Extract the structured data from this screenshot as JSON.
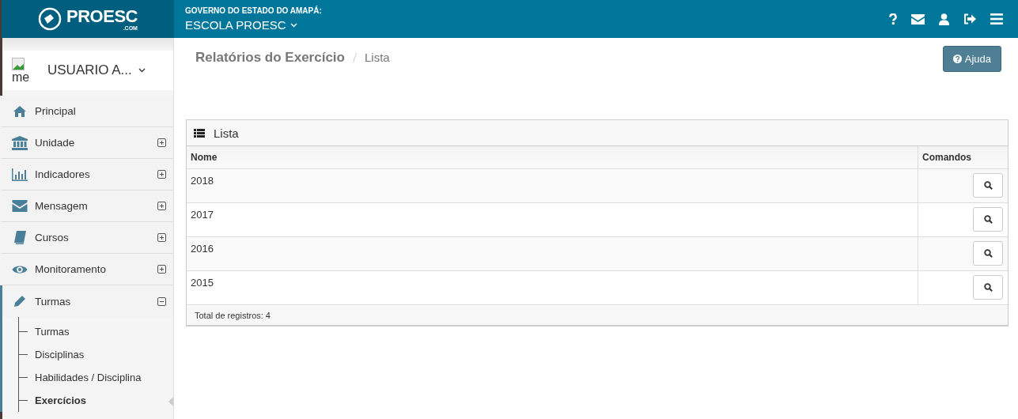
{
  "header": {
    "logo": "PROESC",
    "logo_sub": ".COM",
    "org": "GOVERNO DO ESTADO DO AMAPÁ:",
    "school": "ESCOLA PROESC"
  },
  "user": {
    "image_alt": "me",
    "name": "USUARIO A..."
  },
  "sidebar": {
    "items": [
      {
        "label": "Principal"
      },
      {
        "label": "Unidade",
        "expanded": false
      },
      {
        "label": "Indicadores",
        "expanded": false
      },
      {
        "label": "Mensagem",
        "expanded": false
      },
      {
        "label": "Cursos",
        "expanded": false
      },
      {
        "label": "Monitoramento",
        "expanded": false
      },
      {
        "label": "Turmas",
        "expanded": true,
        "children": [
          {
            "label": "Turmas",
            "selected": false
          },
          {
            "label": "Disciplinas",
            "selected": false
          },
          {
            "label": "Habilidades / Disciplina",
            "selected": false
          },
          {
            "label": "Exercícios",
            "selected": true
          }
        ]
      }
    ]
  },
  "breadcrumb": [
    "Relatórios do Exercício",
    "Lista"
  ],
  "help_button": "Ajuda",
  "panel": {
    "title": "Lista",
    "columns": [
      "Nome",
      "Comandos"
    ],
    "rows": [
      {
        "nome": "2018"
      },
      {
        "nome": "2017"
      },
      {
        "nome": "2016"
      },
      {
        "nome": "2015"
      }
    ],
    "footer": "Total de registros: 4"
  }
}
